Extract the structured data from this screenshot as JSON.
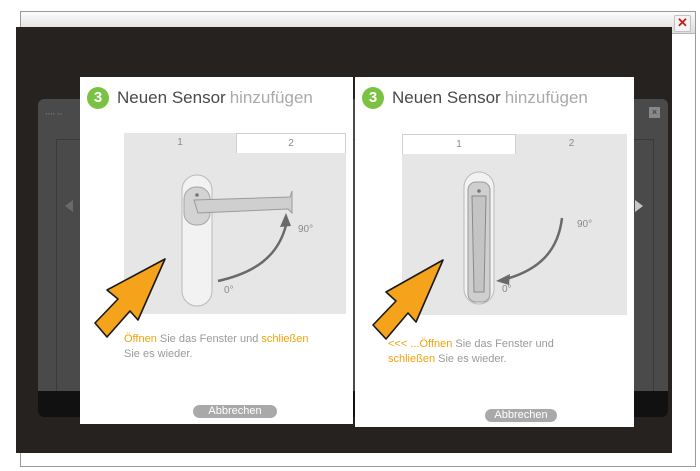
{
  "window": {
    "close_icon": "close-x-icon"
  },
  "panels": [
    {
      "step": "3",
      "title_main": "Neuen Sensor",
      "title_sub": "hinzufügen",
      "tabs": [
        "1",
        "2"
      ],
      "active_tab": "2",
      "angle_start": "0°",
      "angle_end": "90°",
      "desc_hl1": "Öffnen",
      "desc_mid": " Sie das Fenster und ",
      "desc_hl2": "schließen",
      "desc_end": "Sie  es wieder.",
      "cancel": "Abbrechen"
    },
    {
      "step": "3",
      "title_main": "Neuen Sensor",
      "title_sub": "hinzufügen",
      "tabs": [
        "1",
        "2"
      ],
      "active_tab": "1",
      "angle_start": "0°",
      "angle_end": "90°",
      "desc_hl1": "<<<  ...Öffnen",
      "desc_mid": " Sie das Fenster und ",
      "desc_hl2": "schließen",
      "desc_end": " Sie es wieder.",
      "cancel": "Abbrechen"
    }
  ],
  "colors": {
    "accent": "#f0a30a",
    "step": "#7cc242",
    "overlay": "#252220"
  },
  "icons": [
    "close-x-icon",
    "cursor-arrow-icon",
    "window-handle-icon",
    "rotation-arrow-icon"
  ]
}
